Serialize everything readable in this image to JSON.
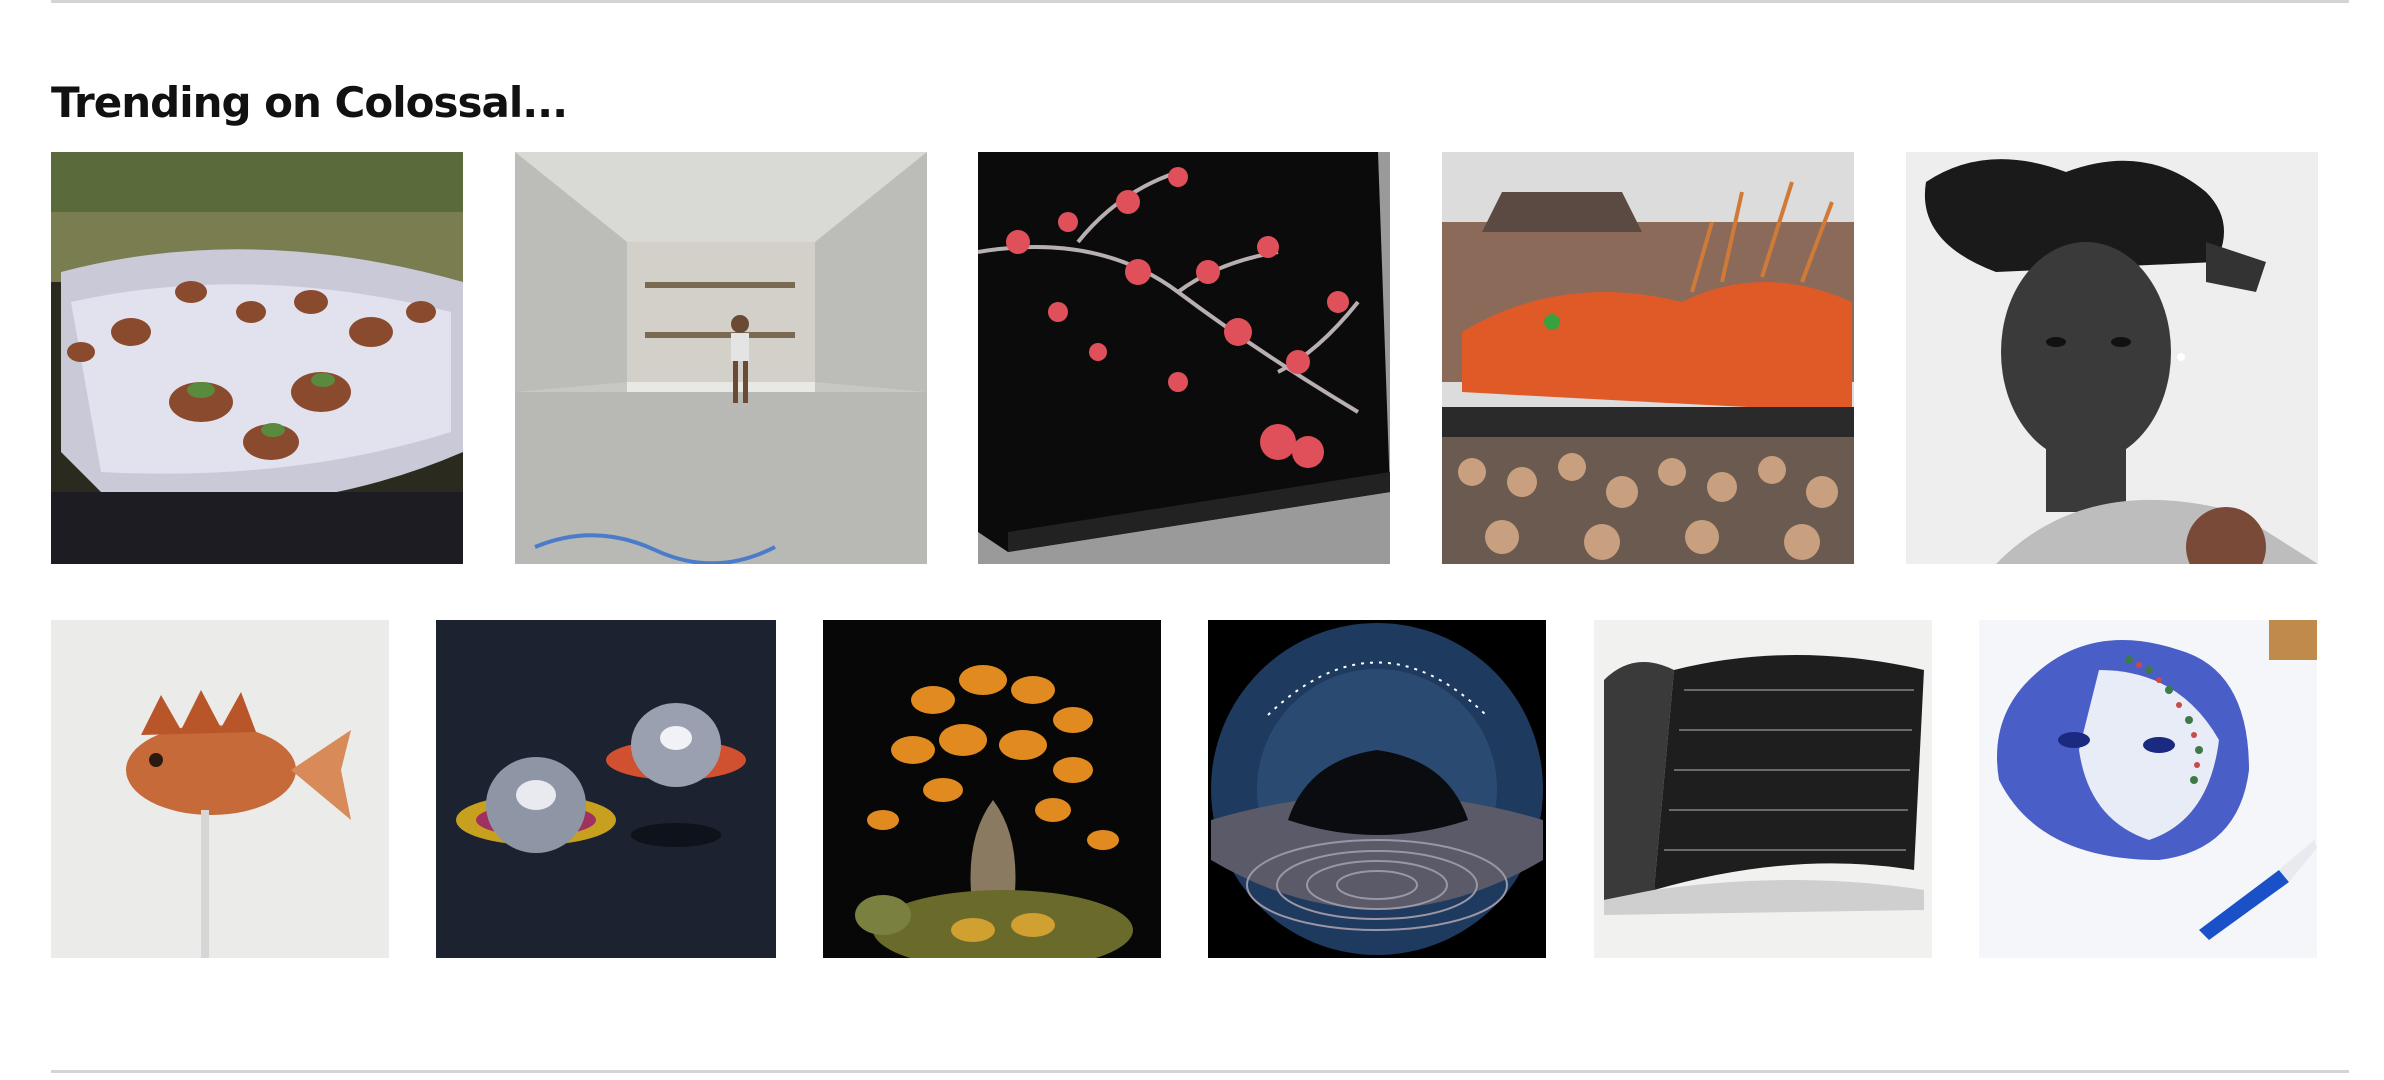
{
  "section": {
    "heading": "Trending on Colossal..."
  },
  "thumbnails_row1": [
    {
      "name": "hummingbirds-fountain-thumb",
      "icon": "hummingbirds-image"
    },
    {
      "name": "under-bridge-office-thumb",
      "icon": "bridge-room-image"
    },
    {
      "name": "cherry-blossom-lacquer-box-thumb",
      "icon": "lacquer-box-image"
    },
    {
      "name": "flower-dragon-parade-thumb",
      "icon": "dragon-float-image"
    },
    {
      "name": "woman-portrait-drawing-thumb",
      "icon": "portrait-image"
    }
  ],
  "thumbnails_row2": [
    {
      "name": "glass-scorpionfish-thumb",
      "icon": "fish-sculpture-image"
    },
    {
      "name": "resin-domes-thumb",
      "icon": "glass-domes-image"
    },
    {
      "name": "butterfly-bonsai-turtle-thumb",
      "icon": "butterfly-tree-image"
    },
    {
      "name": "fisheye-star-trail-thumb",
      "icon": "fisheye-tree-image"
    },
    {
      "name": "hair-book-drawing-thumb",
      "icon": "book-drawing-image"
    },
    {
      "name": "ballpoint-face-embroidery-thumb",
      "icon": "blue-face-image"
    }
  ],
  "colors": {
    "rule": "#d4d4d4",
    "heading": "#111111",
    "background": "#ffffff"
  }
}
